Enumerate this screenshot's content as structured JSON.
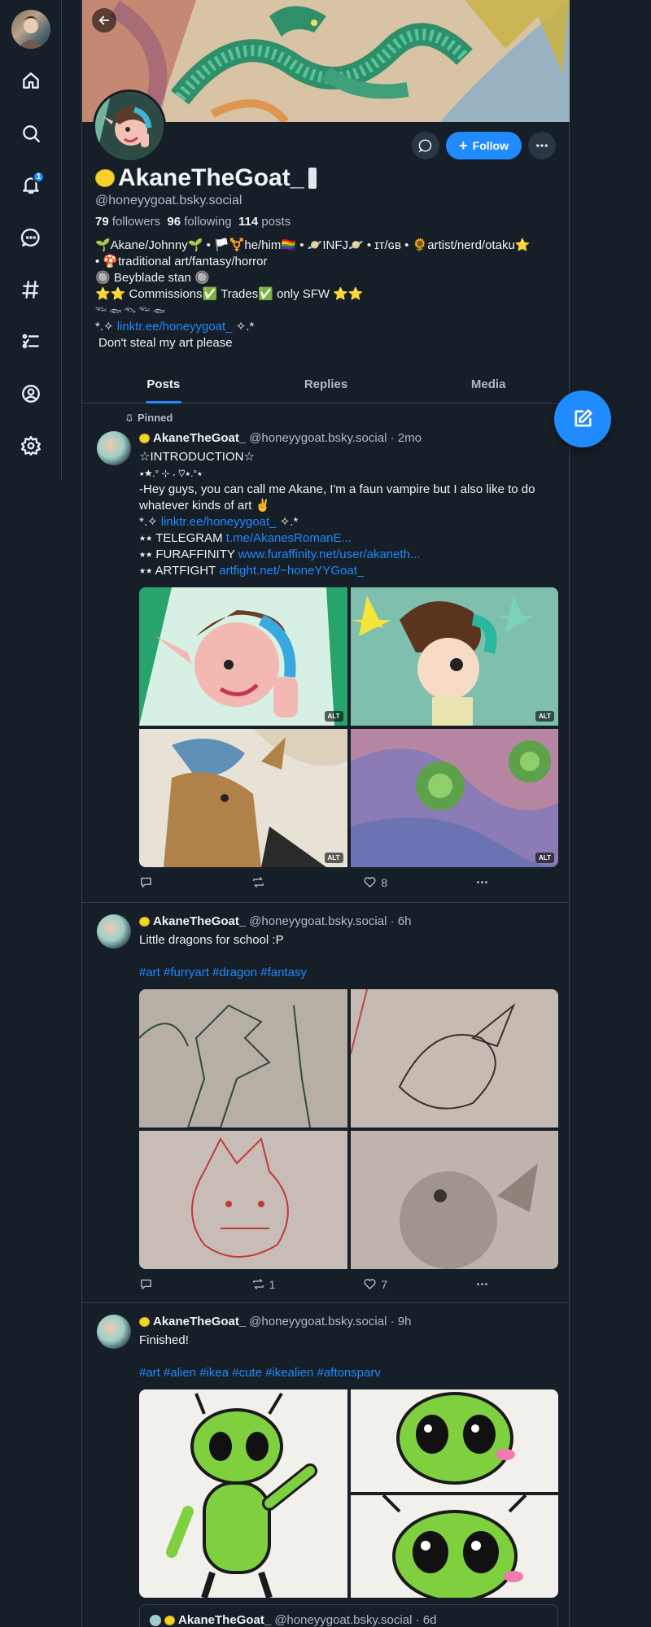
{
  "nav": {
    "notification_count": "1",
    "items": [
      "home-icon",
      "search-icon",
      "bell-icon",
      "chat-icon",
      "hashtag-icon",
      "list-icon",
      "profile-icon",
      "settings-icon"
    ]
  },
  "profile": {
    "display_name": "AkaneTheGoat_",
    "handle": "@honeyygoat.bsky.social",
    "followers_count": "79",
    "followers_label": "followers",
    "following_count": "96",
    "following_label": "following",
    "posts_count": "114",
    "posts_label": "posts",
    "follow_label": "Follow",
    "bio": [
      "🌱Akane/Johnny🌱 • 🏳️⚧️he/him🏳️‍🌈 • 🪐INFJ🪐 • ɪᴛ/ɢʙ • 🌻artist/nerd/otaku⭐",
      "• 🍄traditional art/fantasy/horror",
      "🔘 Beyblade stan 🔘",
      "⭐⭐ Commissions✅ Trades✅ only SFW ⭐⭐",
      "𓆝 𓆟 𓆞 𓆝 𓆟"
    ],
    "bio_link_prefix": "*.✧",
    "bio_link": "linktr.ee/honeyygoat_",
    "bio_link_suffix": "✧.*",
    "bio_last": "Don't steal my art please"
  },
  "tabs": [
    "Posts",
    "Replies",
    "Media"
  ],
  "posts": [
    {
      "pinned_label": "Pinned",
      "name": "AkaneTheGoat_",
      "meta": "@honeyygoat.bsky.social · 2mo",
      "lines": [
        "☆INTRODUCTION☆",
        "⭑★.° ⊹ ˖ ♡⭑.°⭑",
        "-Hey guys, you can call me Akane, I'm a faun vampire but I also like to do whatever kinds of art ✌"
      ],
      "link_line": {
        "prefix": "*.✧",
        "link": "linktr.ee/honeyygoat_",
        "suffix": "✧.*"
      },
      "contacts": [
        {
          "label": "⭑⭑ TELEGRAM",
          "link": "t.me/AkanesRomanE..."
        },
        {
          "label": "⭑⭑ FURAFFINITY",
          "link": "www.furaffinity.net/user/akaneth..."
        },
        {
          "label": "⭑⭑ ARTFIGHT",
          "link": "artfight.net/~honeYYGoat_"
        }
      ],
      "alt_label": "ALT",
      "reposts": "",
      "likes": "8"
    },
    {
      "name": "AkaneTheGoat_",
      "meta": "@honeyygoat.bsky.social · 6h",
      "text": "Little dragons for school :P",
      "tags": "#art #furryart #dragon #fantasy",
      "reposts": "1",
      "likes": "7"
    },
    {
      "name": "AkaneTheGoat_",
      "meta": "@honeyygoat.bsky.social · 9h",
      "text": "Finished!",
      "tags": "#art #alien #ikea #cute #ikealien #aftonsparv",
      "quote_name": "AkaneTheGoat_",
      "quote_meta": "@honeyygoat.bsky.social · 6d"
    }
  ]
}
